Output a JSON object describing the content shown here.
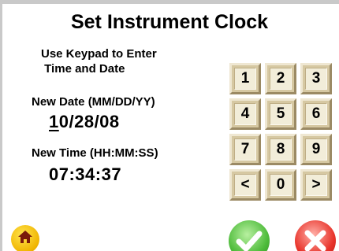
{
  "screen": {
    "title": "Set Instrument Clock",
    "instructions": "Use Keypad to Enter\n Time and Date"
  },
  "date": {
    "label": "New Date (MM/DD/YY)",
    "cursor_digit": "1",
    "rest": "0/28/08"
  },
  "time": {
    "label": "New Time (HH:MM:SS)",
    "value": "07:34:37"
  },
  "keypad": {
    "keys": [
      "1",
      "2",
      "3",
      "4",
      "5",
      "6",
      "7",
      "8",
      "9",
      "<",
      "0",
      ">"
    ]
  },
  "buttons": {
    "home_icon": "home-icon",
    "ok_icon": "checkmark-icon",
    "cancel_icon": "x-icon"
  },
  "colors": {
    "key_face": "#f2edd9",
    "key_border": "#d6c8a2",
    "home": "#f0b400",
    "ok": "#4dbb3a",
    "cancel": "#e8332a"
  }
}
